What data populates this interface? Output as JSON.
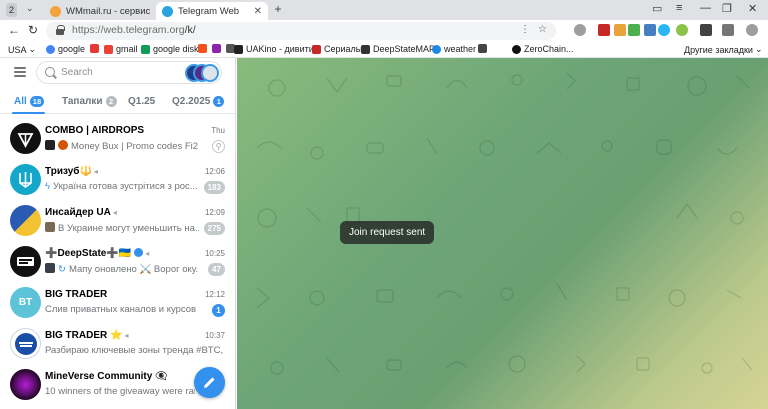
{
  "browser": {
    "tab_count": "2",
    "tabs": [
      {
        "title": "WMmail.ru - сервис почтов",
        "active": false
      },
      {
        "title": "Telegram Web",
        "active": true
      }
    ],
    "url_host": "https://web.telegram.org",
    "url_path": "/k/",
    "bookmarks": [
      {
        "label": "USA",
        "icon": "dropdown-folder"
      },
      {
        "label": "google",
        "icon": "google-icon",
        "color": "#4285f4"
      },
      {
        "label": "",
        "icon": "red-square-icon",
        "color": "#e53935"
      },
      {
        "label": "gmail",
        "icon": "gmail-icon",
        "color": "#ea4335"
      },
      {
        "label": "google disk",
        "icon": "drive-icon",
        "color": "#0f9d58"
      },
      {
        "label": "",
        "icon": "orange-icon",
        "color": "#f4511e"
      },
      {
        "label": "",
        "icon": "colorful-icon",
        "color": "#8e24aa"
      },
      {
        "label": "",
        "icon": "grid-icon",
        "color": "#555555"
      },
      {
        "label": "UAKino - дивитис",
        "icon": "uakino-icon",
        "color": "#222222"
      },
      {
        "label": "Сериалы",
        "icon": "series-icon",
        "color": "#c62828"
      },
      {
        "label": "DeepStateMAP",
        "icon": "deepstate-icon",
        "color": "#333333"
      },
      {
        "label": "weather",
        "icon": "weather-icon",
        "color": "#1e88e5"
      },
      {
        "label": "",
        "icon": "ib-icon",
        "color": "#444444"
      },
      {
        "label": "ZeroChain...",
        "icon": "zerochain-icon",
        "color": "#111111"
      }
    ],
    "other_bookmarks": "Другие закладки"
  },
  "telegram": {
    "search_placeholder": "Search",
    "folders": [
      {
        "label": "All",
        "count": "18",
        "active": true
      },
      {
        "label": "Тапалки",
        "count": "2",
        "active": false
      },
      {
        "label": "Q1.25",
        "count": "",
        "active": false
      },
      {
        "label": "Q2.2025",
        "count": "1",
        "active": false
      }
    ],
    "chats": [
      {
        "name": "COMBO | AIRDROPS",
        "time": "Thu",
        "preview": "Money Bux | Promo codes  Fi2...",
        "unread": "",
        "pinned": true,
        "avatar_color": "#111111",
        "avatar_text": ""
      },
      {
        "name": "Тризуб🔱",
        "time": "12:06",
        "preview": "Україна готова зустрітися з рос...",
        "unread": "183",
        "pinned": false,
        "avatar_color": "#14a7c9",
        "avatar_text": ""
      },
      {
        "name": "Инсайдер UA",
        "time": "12:09",
        "preview": "В Украине могут уменьшить на...",
        "unread": "275",
        "pinned": false,
        "avatar_color": "#2a5bb3",
        "avatar_text": ""
      },
      {
        "name": "➕DeepState➕🇺🇦",
        "time": "10:25",
        "preview": "Мапу оновлено ⚔️ Ворог оку...",
        "unread": "47",
        "pinned": false,
        "avatar_color": "#111111",
        "avatar_text": ""
      },
      {
        "name": "BIG TRADER",
        "time": "12:12",
        "preview": "Слив приватных каналов и курсов о...",
        "unread": "1",
        "unread_blue": true,
        "pinned": false,
        "avatar_color": "#5cc3d9",
        "avatar_text": "BT"
      },
      {
        "name": "BIG TRADER ⭐",
        "time": "10:37",
        "preview": "Разбираю ключевые зоны тренда #BTC, ...",
        "unread": "",
        "pinned": false,
        "avatar_color": "#1a4ea8",
        "avatar_text": ""
      },
      {
        "name": "MineVerse Community 👁‍🗨",
        "time": "",
        "preview": "10 winners of the giveaway were rand...",
        "unread": "",
        "pinned": false,
        "avatar_color": "#3a0c3e",
        "avatar_text": ""
      }
    ]
  },
  "chat_area": {
    "toast": "Join request sent"
  }
}
